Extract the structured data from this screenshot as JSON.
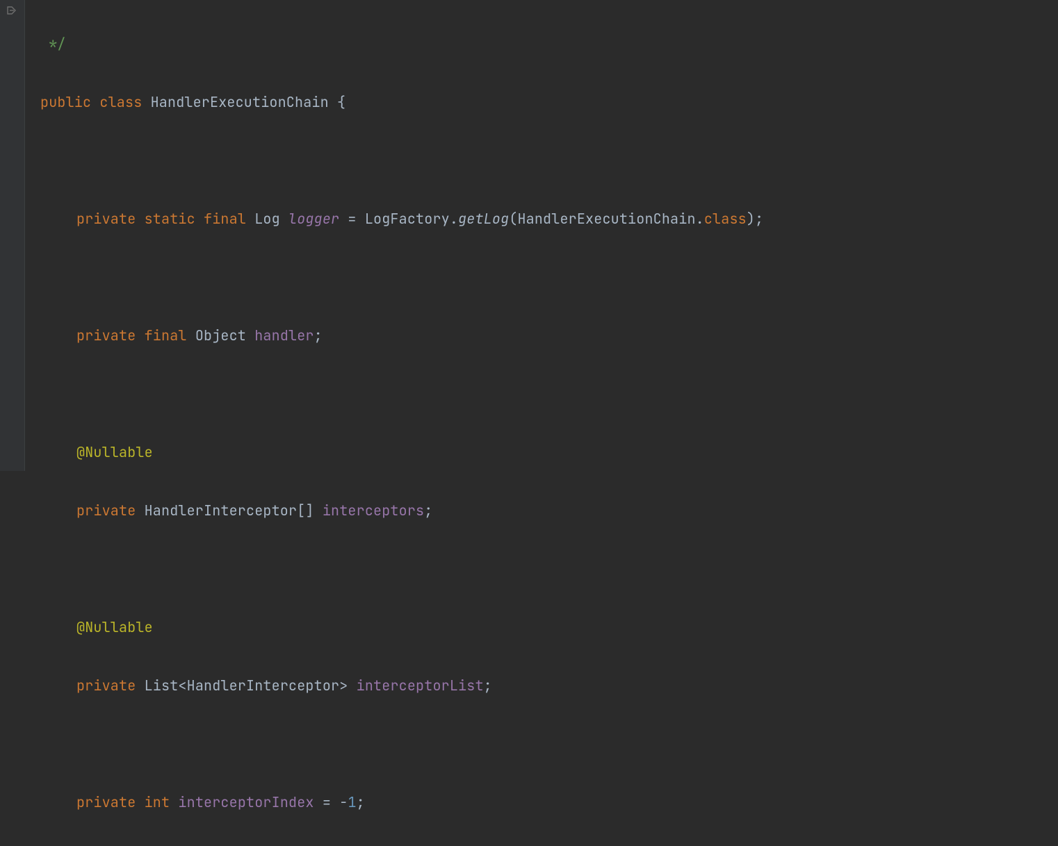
{
  "comment_close": "*/",
  "kw_public": "public",
  "kw_class": "class",
  "class_name": "HandlerExecutionChain",
  "brace_open": "{",
  "kw_private": "private",
  "kw_static": "static",
  "kw_final": "final",
  "type_Log": "Log",
  "field_logger": "logger",
  "op_eq": " = ",
  "type_LogFactory": "LogFactory",
  "dot": ".",
  "method_getLog": "getLog",
  "paren_open": "(",
  "ref_HandlerExecutionChain": "HandlerExecutionChain",
  "kw_classref": "class",
  "paren_close": ")",
  "semi": ";",
  "type_Object": "Object",
  "field_handler": "handler",
  "annotation_Nullable": "@Nullable",
  "type_HandlerInterceptor": "HandlerInterceptor",
  "brackets": "[]",
  "field_interceptors": "interceptors",
  "type_List": "List",
  "lt": "<",
  "gt": ">",
  "field_interceptorList": "interceptorList",
  "kw_int": "int",
  "field_interceptorIndex": "interceptorIndex",
  "minus": "-",
  "num_1": "1"
}
